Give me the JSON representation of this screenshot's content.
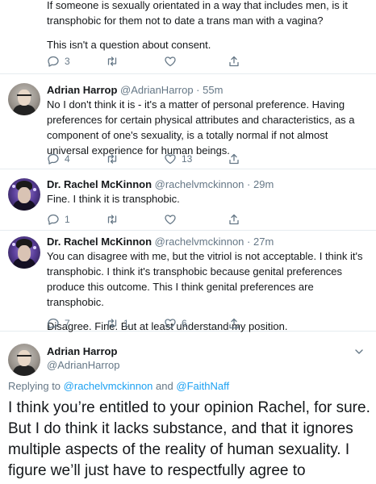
{
  "top_tweet": {
    "lines": [
      "If someone is sexually orientated in a way that includes men, is it transphobic for them not to date a trans man with a vagina?",
      "This isn't a question about consent."
    ],
    "reply_count": "3",
    "retweet_count": "",
    "like_count": ""
  },
  "tweet1": {
    "name": "Adrian Harrop",
    "handle": "@AdrianHarrop",
    "separator": "·",
    "time": "55m",
    "text": "No I don't think it is - it's a matter of personal preference. Having preferences for certain physical attributes and characteristics, as a component of one's sexuality, is a totally normal if not almost universal experience for human beings.",
    "reply_count": "4",
    "retweet_count": "",
    "like_count": "13"
  },
  "tweet2": {
    "name": "Dr. Rachel McKinnon",
    "handle": "@rachelvmckinnon",
    "separator": "·",
    "time": "29m",
    "text": "Fine. I think it is transphobic.",
    "reply_count": "1",
    "retweet_count": "",
    "like_count": ""
  },
  "tweet3": {
    "name": "Dr. Rachel McKinnon",
    "handle": "@rachelvmckinnon",
    "separator": "·",
    "time": "27m",
    "paragraphs": [
      "You can disagree with me, but the vitriol is not acceptable. I think it's transphobic. I think it's transphobic because genital preferences produce this outcome. This I think genital preferences are transphobic.",
      "Disagree. Fine. But at least understand my position."
    ],
    "reply_count": "7",
    "retweet_count": "1",
    "like_count": "6"
  },
  "focused_tweet": {
    "name": "Adrian Harrop",
    "handle": "@AdrianHarrop",
    "replying_prefix": "Replying to",
    "mention1": "@rachelvmckinnon",
    "and_word": "and",
    "mention2": "@FaithNaff",
    "text": "I think you’re entitled to your opinion Rachel, for sure. But I do think it lacks substance, and that it ignores multiple aspects of the reality of human sexuality. I figure we’ll just have to respectfully agree to disagree."
  },
  "icons": {
    "reply": "reply-icon",
    "retweet": "retweet-icon",
    "like": "heart-icon",
    "share": "share-icon",
    "menu": "chevron-down-icon"
  },
  "colors": {
    "text": "#14171a",
    "secondary": "#657786",
    "link": "#1da1f2",
    "divider": "#e6ecf0"
  }
}
